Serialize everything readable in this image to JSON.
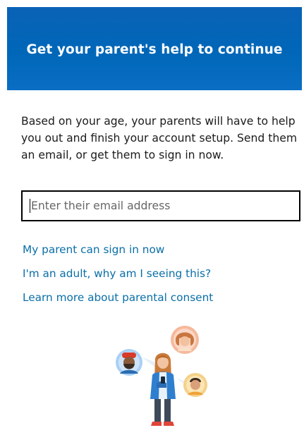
{
  "header": {
    "title": "Get your parent's help to continue"
  },
  "main": {
    "description": "Based on your age, your parents will have to help you out and finish your account setup. Send them an email, or get them to sign in now.",
    "email_field": {
      "value": "",
      "placeholder": "Enter their email address"
    },
    "links": [
      {
        "label": "My parent can sign in now"
      },
      {
        "label": "I'm an adult, why am I seeing this?"
      },
      {
        "label": "Learn more about parental consent"
      }
    ]
  },
  "colors": {
    "header_background": "#0067b8",
    "header_text": "#ffffff",
    "body_text": "#1b1b1b",
    "link": "#0a6fa8",
    "input_border": "#000000"
  },
  "icons": {
    "illustration": "family-illustration"
  }
}
